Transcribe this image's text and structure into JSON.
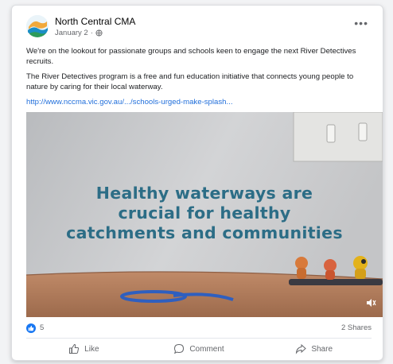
{
  "post": {
    "page_name": "North Central CMA",
    "date": "January 2",
    "paragraphs": [
      "We're on the lookout for passionate groups and schools keen to engage the next River Detectives recruits.",
      "The River Detectives program is a free and fun education initiative that connects young people to nature by caring for their local waterway."
    ],
    "link": "http://www.nccma.vic.gov.au/.../schools-urged-make-splash..."
  },
  "video": {
    "caption_lines": [
      "Healthy waterways are",
      "crucial for healthy",
      "catchments and communities"
    ]
  },
  "stats": {
    "like_count": "5",
    "shares": "2 Shares"
  },
  "actions": {
    "like": "Like",
    "comment": "Comment",
    "share": "Share"
  },
  "icons": [
    "logo-icon",
    "globe-icon",
    "more-options-icon",
    "like-reaction-icon",
    "thumbs-up-icon",
    "comment-icon",
    "share-icon",
    "mute-icon"
  ],
  "colors": {
    "accent": "#1877f2",
    "link": "#216fdb",
    "video_text": "#2c6d86"
  }
}
